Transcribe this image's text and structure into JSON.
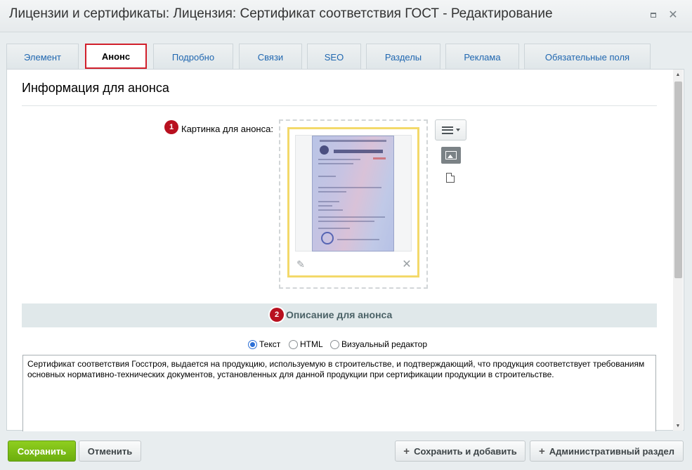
{
  "window": {
    "title": "Лицензии и сертификаты: Лицензия: Сертификат соответствия ГОСТ - Редактирование",
    "maximize_icon": "maximize-icon",
    "close_icon": "close-icon",
    "close_glyph": "✕"
  },
  "tabs": [
    {
      "label": "Элемент",
      "active": false
    },
    {
      "label": "Анонс",
      "active": true
    },
    {
      "label": "Подробно",
      "active": false
    },
    {
      "label": "Связи",
      "active": false
    },
    {
      "label": "SEO",
      "active": false
    },
    {
      "label": "Разделы",
      "active": false
    },
    {
      "label": "Реклама",
      "active": false
    },
    {
      "label": "Обязательные поля",
      "active": false
    }
  ],
  "section": {
    "title": "Информация для анонса"
  },
  "preview_image": {
    "badge": "1",
    "label": "Картинка для анонса:",
    "edit_glyph": "✎",
    "remove_glyph": "✕",
    "icons": [
      "menu-icon",
      "image-icon",
      "file-icon",
      "edit-icon",
      "remove-icon"
    ]
  },
  "description": {
    "badge": "2",
    "title": "Описание для анонса",
    "modes": [
      {
        "label": "Текст",
        "selected": true
      },
      {
        "label": "HTML",
        "selected": false
      },
      {
        "label": "Визуальный редактор",
        "selected": false
      }
    ],
    "text": "Сертификат соответствия Госстроя, выдается на продукцию, используемую в строительстве, и подтверждающий, что продукция соответствует требованиям основных нормативно-технических документов, установленных для данной продукции при сертификации продукции в строительстве."
  },
  "footer": {
    "save": "Сохранить",
    "cancel": "Отменить",
    "save_add": "Сохранить и добавить",
    "admin": "Административный раздел",
    "plus_glyph": "+"
  },
  "colors": {
    "active_tab_border": "#d11f2b",
    "badge": "#b8101f",
    "save_button": "#7abf15",
    "image_highlight": "#f3d96a"
  }
}
